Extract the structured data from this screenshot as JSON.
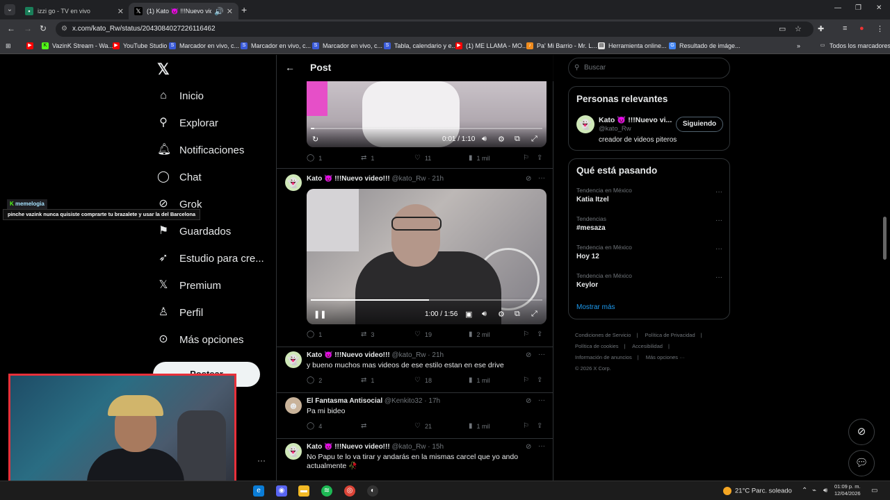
{
  "browser": {
    "tabs": [
      {
        "title": "izzi go - TV en vivo",
        "active": false
      },
      {
        "title": "(1) Kato 😈 !!!Nuevo video!!!",
        "active": true
      }
    ],
    "url": "x.com/kato_Rw/status/2043084027226116462",
    "bookmarks": [
      "VazinK Stream - Wa...",
      "YouTube Studio",
      "Marcador en vivo, c...",
      "Marcador en vivo, c...",
      "Marcador en vivo, c...",
      "Tabla, calendario y e...",
      "(1) ME LLAMA - MO...",
      "Pa' Mi Barrio - Mr. L...",
      "Herramienta online...",
      "Resultado de imáge..."
    ],
    "all_bookmarks": "Todos los marcadores"
  },
  "nav": {
    "items": [
      "Inicio",
      "Explorar",
      "Notificaciones",
      "Chat",
      "Grok",
      "Guardados",
      "Estudio para cre...",
      "Premium",
      "Perfil",
      "Más opciones"
    ],
    "notif_badge": "1",
    "post_button": "Postear"
  },
  "header": {
    "title": "Post"
  },
  "video1": {
    "time": "0:01 / 1:10",
    "progress": 0.015
  },
  "tweets": [
    {
      "actions": {
        "replies": "1",
        "reposts": "1",
        "likes": "11",
        "views": "1 mil"
      }
    },
    {
      "name": "Kato 😈 !!!Nuevo video!!!",
      "handle": "@kato_Rw",
      "time": "21h",
      "video_time": "1:00 / 1:56",
      "progress": 0.51,
      "actions": {
        "replies": "1",
        "reposts": "3",
        "likes": "19",
        "views": "2 mil"
      }
    },
    {
      "name": "Kato 😈 !!!Nuevo video!!!",
      "handle": "@kato_Rw",
      "time": "21h",
      "text": "y bueno muchos mas videos de ese estilo estan en ese drive",
      "actions": {
        "replies": "2",
        "reposts": "1",
        "likes": "18",
        "views": "1 mil"
      }
    },
    {
      "name": "El Fantasma Antisocial",
      "handle": "@Kenkito32",
      "time": "17h",
      "text": "Pa mi bideo",
      "actions": {
        "replies": "4",
        "reposts": "",
        "likes": "21",
        "views": "1 mil"
      }
    },
    {
      "name": "Kato 😈 !!!Nuevo video!!!",
      "handle": "@kato_Rw",
      "time": "15h",
      "text": "No Papu te lo va tirar y andarás en la mismas carcel que yo ando actualmente 🥀"
    }
  ],
  "search": {
    "placeholder": "Buscar"
  },
  "relevant": {
    "title": "Personas relevantes",
    "name": "Kato 😈 !!!Nuevo vi...",
    "handle": "@kato_Rw",
    "bio": "creador de videos piteros",
    "follow": "Siguiendo"
  },
  "trends": {
    "title": "Qué está pasando",
    "items": [
      {
        "context": "Tendencia en México",
        "name": "Katia Itzel"
      },
      {
        "context": "Tendencias",
        "name": "#mesaza"
      },
      {
        "context": "Tendencia en México",
        "name": "Hoy 12"
      },
      {
        "context": "Tendencia en México",
        "name": "Keylor"
      }
    ],
    "show_more": "Mostrar más"
  },
  "footer": {
    "links": [
      "Condiciones de Servicio",
      "Política de Privacidad",
      "Política de cookies",
      "Accesibilidad",
      "Información de anuncios",
      "Más opciones ···"
    ],
    "copyright": "© 2026 X Corp."
  },
  "overlay": {
    "chat_user": "memelogia",
    "chat_message": "pinche vazink nunca quisiste comprarte tu brazalete y usar la del Barcelona"
  },
  "taskbar": {
    "weather": "21°C  Parc. soleado",
    "time": "01:09 p. m.",
    "date": "12/04/2026"
  }
}
